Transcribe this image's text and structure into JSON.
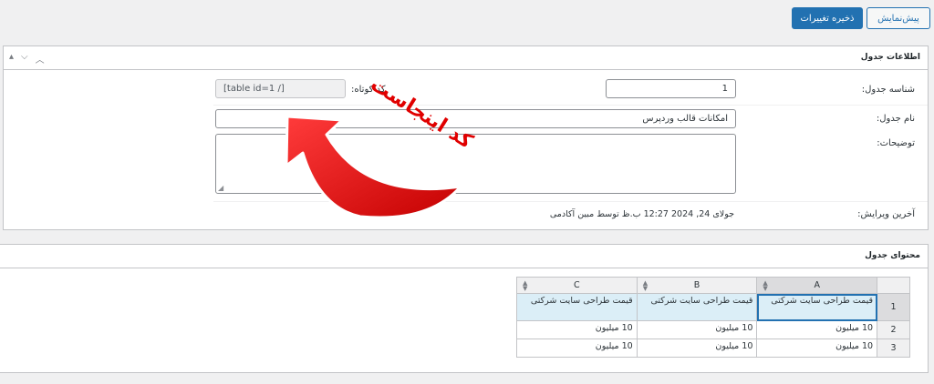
{
  "toolbar": {
    "preview_label": "پیش‌نمایش",
    "save_label": "ذخیره تغییرات"
  },
  "table_info": {
    "title": "اطلاعات جدول",
    "table_id_label": "شناسه جدول:",
    "table_id_value": "1",
    "shortcode_label": "کد کوتاه:",
    "shortcode_value": "[table id=1 /]",
    "table_name_label": "نام جدول:",
    "table_name_value": "امکانات قالب وردپرس",
    "description_label": "توضیحات:",
    "description_value": "",
    "last_edit_label": "آخرین ویرایش:",
    "last_edit_value": "جولای 24, 2024 12:27 ب.ظ توسط مبین آکادمی"
  },
  "annotation": {
    "text": "کد اینجاست",
    "color": "#e00000"
  },
  "table_content": {
    "title": "محتوای جدول",
    "columns": [
      "A",
      "B",
      "C"
    ],
    "rows": [
      {
        "num": "1",
        "cells": [
          "قیمت طراحی سایت شرکتی",
          "قیمت طراحی سایت شرکتی",
          "قیمت طراحی سایت شرکتی"
        ]
      },
      {
        "num": "2",
        "cells": [
          "10 میلیون",
          "10 میلیون",
          "10 میلیون"
        ]
      },
      {
        "num": "3",
        "cells": [
          "10 میلیون",
          "10 میلیون",
          "10 میلیون"
        ]
      }
    ]
  },
  "colors": {
    "primary": "#2271b1",
    "selected_cell": "#dbeef7"
  }
}
